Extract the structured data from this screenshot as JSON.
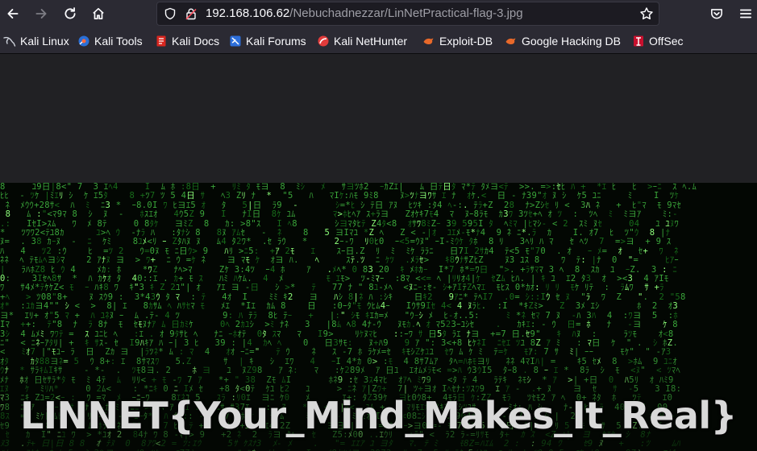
{
  "browser": {
    "url_host": "192.168.106.62",
    "url_path": "/Nebuchadnezzar/LinNetPractical-flag-3.jpg"
  },
  "bookmarks": [
    {
      "label": "Kali Linux",
      "icon": "kali-dragon-icon"
    },
    {
      "label": "Kali Tools",
      "icon": "kali-tools-icon"
    },
    {
      "label": "Kali Docs",
      "icon": "kali-docs-icon"
    },
    {
      "label": "Kali Forums",
      "icon": "kali-forums-icon"
    },
    {
      "label": "Kali NetHunter",
      "icon": "nethunter-icon"
    },
    {
      "label": "Exploit-DB",
      "icon": "exploit-db-icon"
    },
    {
      "label": "Google Hacking DB",
      "icon": "ghdb-icon"
    },
    {
      "label": "OffSec",
      "icon": "offsec-icon"
    }
  ],
  "image": {
    "flag_text": "LINNET{Your_Mind_Makes_It_Real}",
    "style": "matrix-digital-rain"
  },
  "colors": {
    "toolbar_bg": "#2b2a33",
    "viewport_bg": "#212124",
    "rain_green": "#3aa53a",
    "flag_text": "#d9d9d9"
  }
}
